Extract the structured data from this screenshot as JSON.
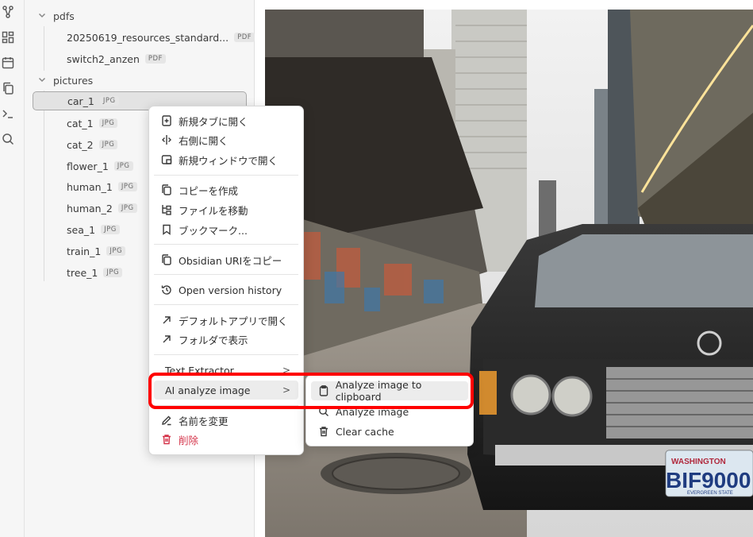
{
  "ribbon": {
    "icons": [
      "graph-icon",
      "dashboard-icon",
      "calendar-icon",
      "copy-icon",
      "terminal-icon",
      "search-icon"
    ]
  },
  "explorer": {
    "folders": [
      {
        "name": "pdfs"
      },
      {
        "name": "pictures"
      }
    ],
    "pdf_files": [
      {
        "name": "20250619_resources_standard...",
        "ext": "PDF"
      },
      {
        "name": "switch2_anzen",
        "ext": "PDF"
      }
    ],
    "picture_files": [
      {
        "name": "car_1",
        "ext": "JPG"
      },
      {
        "name": "cat_1",
        "ext": "JPG"
      },
      {
        "name": "cat_2",
        "ext": "JPG"
      },
      {
        "name": "flower_1",
        "ext": "JPG"
      },
      {
        "name": "human_1",
        "ext": "JPG"
      },
      {
        "name": "human_2",
        "ext": "JPG"
      },
      {
        "name": "sea_1",
        "ext": "JPG"
      },
      {
        "name": "train_1",
        "ext": "JPG"
      },
      {
        "name": "tree_1",
        "ext": "JPG"
      }
    ]
  },
  "context_menu": {
    "open_new_tab": "新規タブに開く",
    "open_right": "右側に開く",
    "open_new_window": "新規ウィンドウで開く",
    "make_copy": "コピーを作成",
    "move_file": "ファイルを移動",
    "bookmark": "ブックマーク...",
    "copy_uri": "Obsidian URIをコピー",
    "version_history": "Open version history",
    "open_default_app": "デフォルトアプリで開く",
    "show_in_folder": "フォルダで表示",
    "text_extractor": "Text Extractor",
    "ai_analyze": "AI analyze image",
    "rename": "名前を変更",
    "delete": "削除"
  },
  "submenu": {
    "analyze_clipboard": "Analyze image to clipboard",
    "analyze_image": "Analyze image",
    "clear_cache": "Clear cache"
  },
  "photo": {
    "plate_state": "WASHINGTON",
    "plate_number": "BIF9000",
    "plate_bottom": "EVERGREEN STATE"
  },
  "colors": {
    "highlight_box": "#ff0000",
    "danger": "#d5344a"
  }
}
